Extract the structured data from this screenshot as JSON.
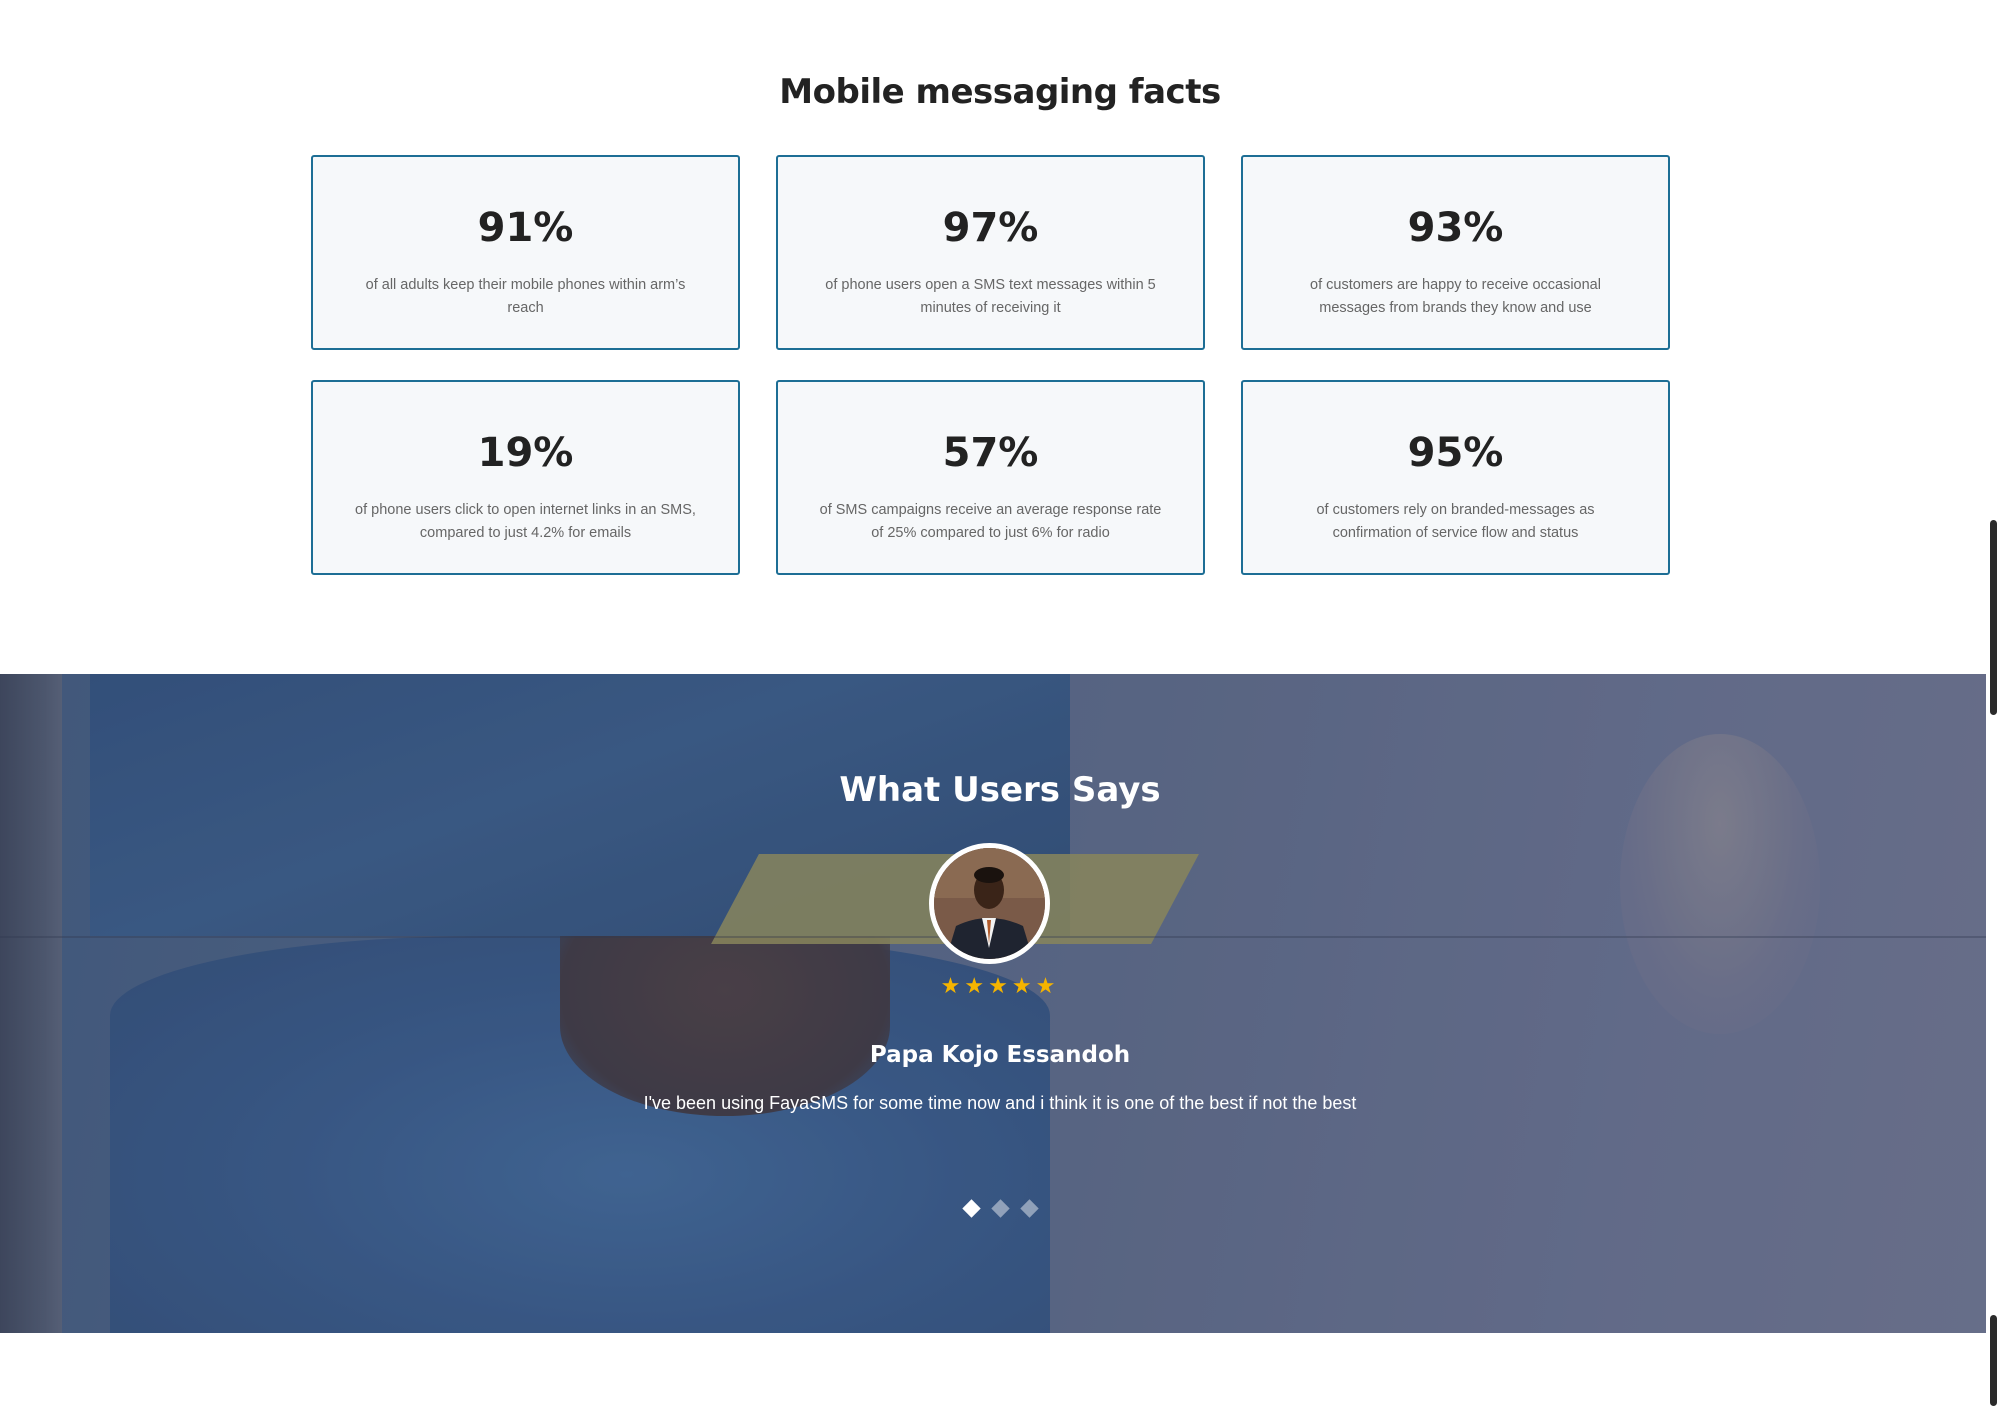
{
  "facts": {
    "title": "Mobile messaging facts",
    "cards": [
      {
        "value": "91%",
        "description": "of all adults keep their mobile phones within arm’s reach"
      },
      {
        "value": "97%",
        "description": "of phone users open a SMS text messages within 5 minutes of receiving it"
      },
      {
        "value": "93%",
        "description": "of customers are happy to receive occasional messages from brands they know and use"
      },
      {
        "value": "19%",
        "description": "of phone users click to open internet links in an SMS, compared to just 4.2% for emails"
      },
      {
        "value": "57%",
        "description": "of SMS campaigns receive an average response rate of 25% compared to just 6% for radio"
      },
      {
        "value": "95%",
        "description": "of customers rely on branded-messages as confirmation of service flow and status"
      }
    ]
  },
  "testimonials": {
    "title": "What Users Says",
    "rating": 5,
    "star_glyph": "★",
    "star_color": "#f5b400",
    "author": "Papa Kojo Essandoh",
    "quote": "I've been using FayaSMS for some time now and i think it is one of the best if not the best",
    "slide_count": 3,
    "active_slide": 1
  },
  "colors": {
    "card_border": "#1d6e95",
    "card_background": "#f6f8fa"
  }
}
